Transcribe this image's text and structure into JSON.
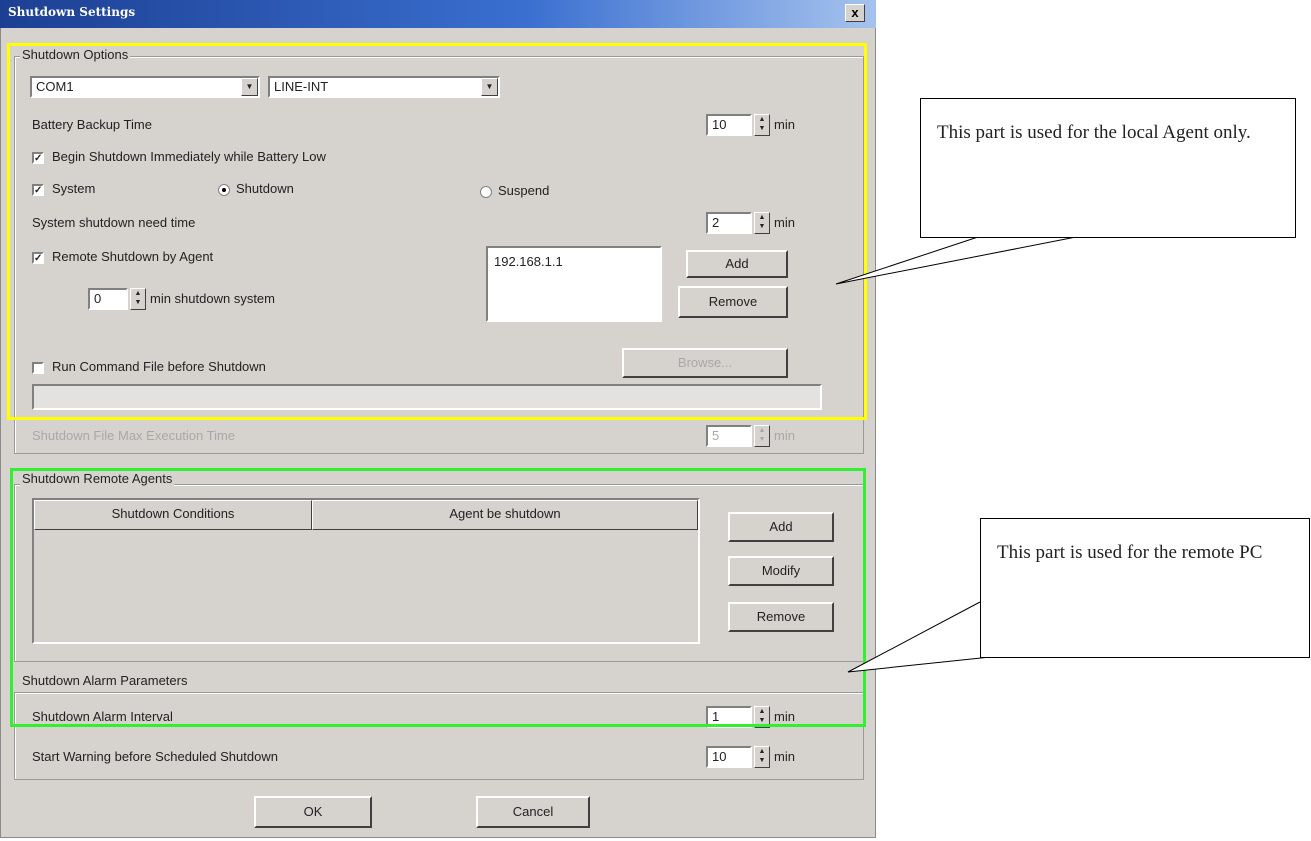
{
  "window": {
    "title": "Shutdown Settings",
    "close_label": "x"
  },
  "shutdown_options": {
    "group_label": "Shutdown Options",
    "port": "COM1",
    "ups_type": "LINE-INT",
    "battery_backup_label": "Battery Backup Time",
    "battery_backup_value": "10",
    "battery_backup_unit": "min",
    "begin_shutdown_label": "Begin Shutdown Immediately while Battery Low",
    "begin_shutdown_checked": true,
    "system_label": "System",
    "system_checked": true,
    "shutdown_radio_label": "Shutdown",
    "suspend_radio_label": "Suspend",
    "selected_mode": "Shutdown",
    "system_need_time_label": "System shutdown need time",
    "system_need_time_value": "2",
    "system_need_time_unit": "min",
    "remote_by_agent_label": "Remote Shutdown by Agent",
    "remote_by_agent_checked": true,
    "remote_minutes_value": "0",
    "remote_minutes_suffix": "min shutdown system",
    "agent_list": [
      "192.168.1.1"
    ],
    "add_label": "Add",
    "remove_label": "Remove",
    "run_command_label": "Run Command File before Shutdown",
    "run_command_checked": false,
    "browse_label": "Browse...",
    "command_path": "",
    "max_exec_label": "Shutdown File Max Execution Time",
    "max_exec_value": "5",
    "max_exec_unit": "min"
  },
  "remote_agents": {
    "group_label": "Shutdown Remote Agents",
    "columns": [
      "Shutdown Conditions",
      "Agent be shutdown"
    ],
    "rows": [],
    "add_label": "Add",
    "modify_label": "Modify",
    "remove_label": "Remove"
  },
  "alarm": {
    "group_label": "Shutdown Alarm Parameters",
    "interval_label": "Shutdown Alarm Interval",
    "interval_value": "1",
    "interval_unit": "min",
    "warning_label": "Start Warning before Scheduled Shutdown",
    "warning_value": "10",
    "warning_unit": "min"
  },
  "footer": {
    "ok_label": "OK",
    "cancel_label": "Cancel"
  },
  "callouts": {
    "local": "This part is used for the local Agent only.",
    "remote": "This part is used for the remote PC"
  },
  "colors": {
    "highlight_local": "#ffff00",
    "highlight_remote": "#33ee33"
  }
}
